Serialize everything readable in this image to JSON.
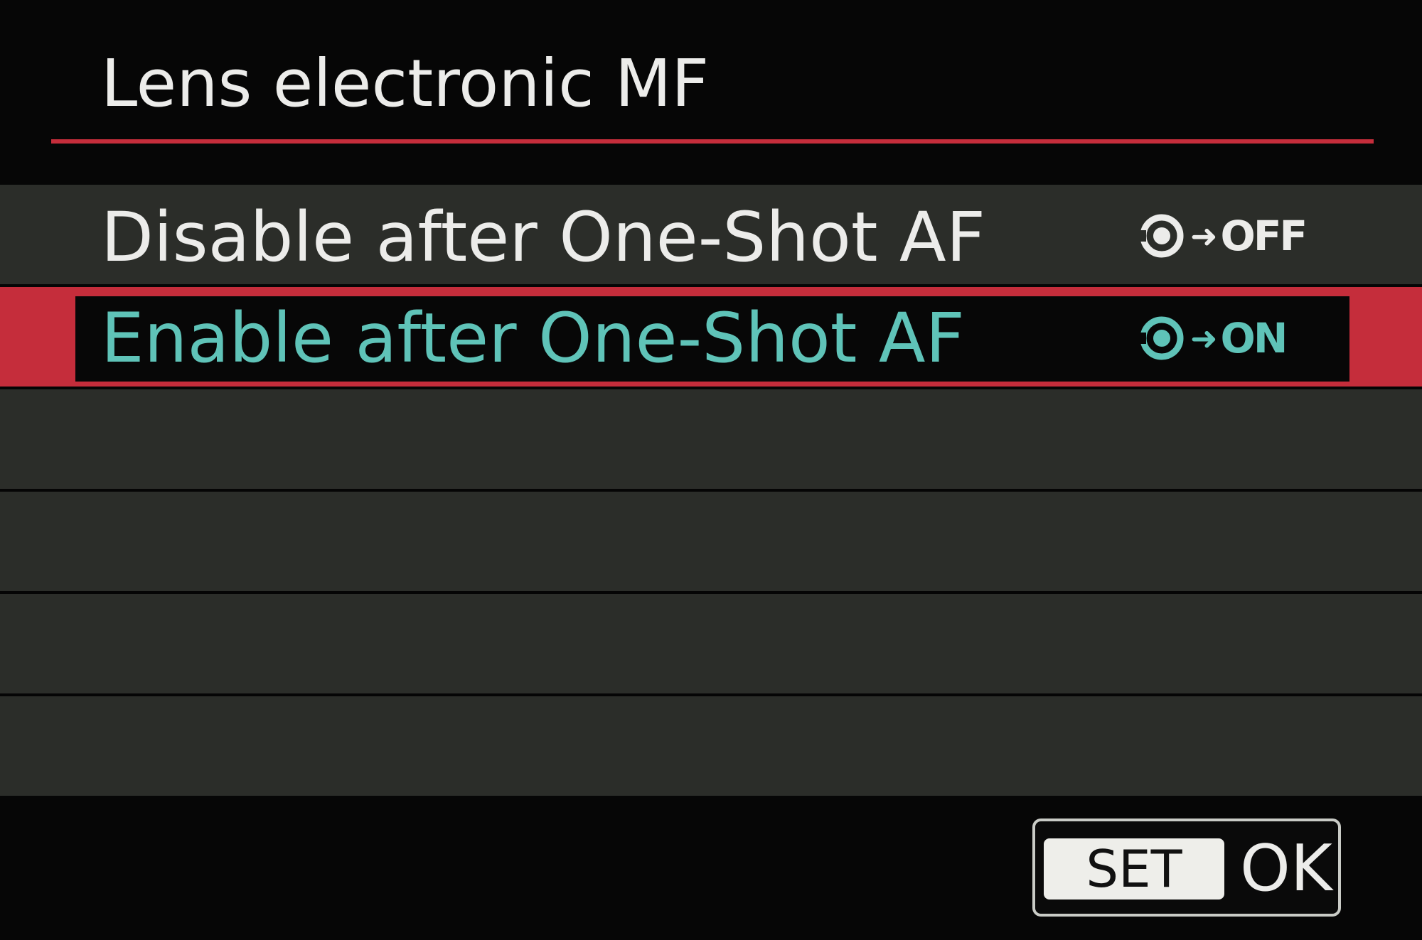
{
  "screen": {
    "title": "Lens electronic MF"
  },
  "options": [
    {
      "label": "Disable after One-Shot AF",
      "status": "OFF",
      "status_icon": "mf-focus-ring-icon",
      "selected": false
    },
    {
      "label": "Enable after One-Shot AF",
      "status": "ON",
      "status_icon": "mf-focus-ring-icon",
      "selected": true
    }
  ],
  "footer": {
    "set_key": "SET",
    "ok_label": "OK"
  },
  "colors": {
    "background": "#060606",
    "row": "#2b2d29",
    "accent_red": "#c52d3b",
    "text": "#ececea",
    "selected_text": "#5fc3b8"
  }
}
